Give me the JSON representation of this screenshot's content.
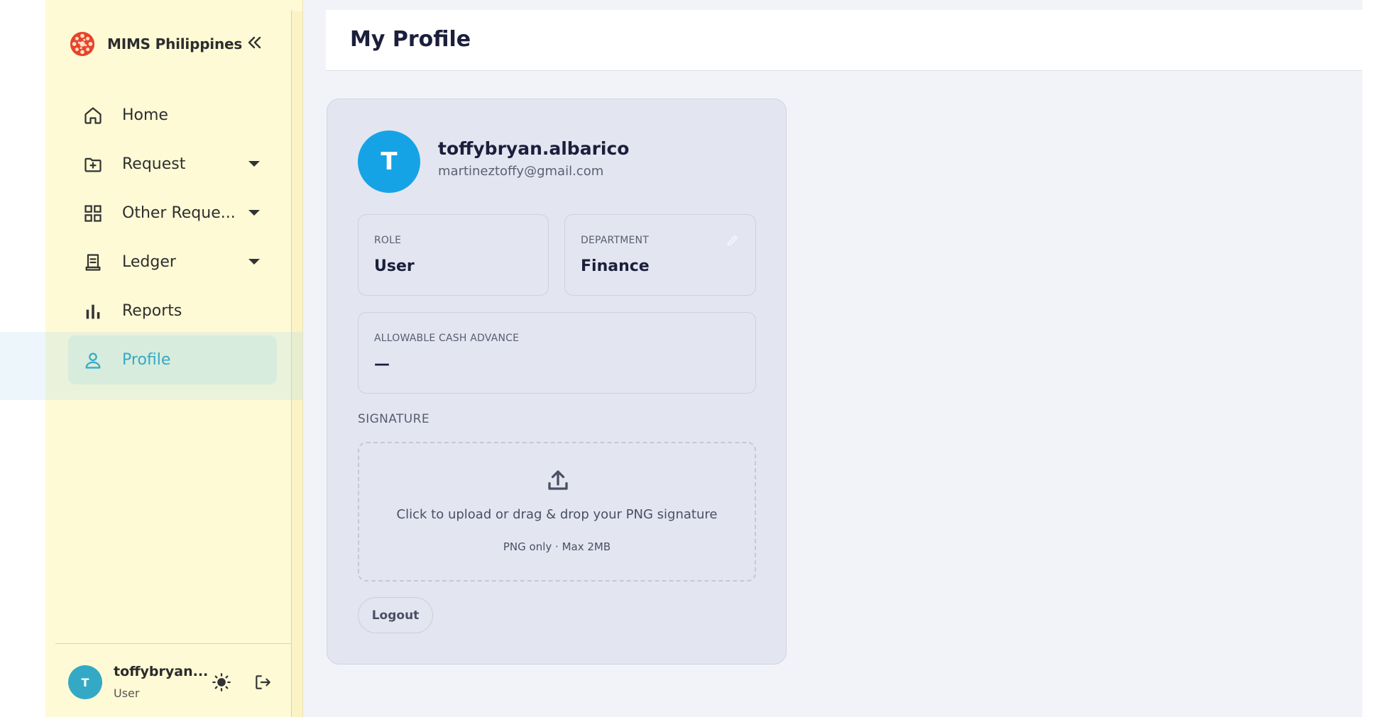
{
  "brand": {
    "name": "MIMS Philippines"
  },
  "sidebar": {
    "items": [
      {
        "label": "Home",
        "icon": "home-icon"
      },
      {
        "label": "Request",
        "icon": "folder-plus-icon",
        "has_caret": true
      },
      {
        "label": "Other Reque...",
        "icon": "grid-icon",
        "has_caret": true
      },
      {
        "label": "Ledger",
        "icon": "receipt-icon",
        "has_caret": true
      },
      {
        "label": "Reports",
        "icon": "bar-chart-icon"
      },
      {
        "label": "Profile",
        "icon": "user-icon",
        "active": true
      }
    ],
    "footer": {
      "avatar_initial": "T",
      "name": "toffybryan...",
      "role": "User"
    }
  },
  "header": {
    "title": "My Profile"
  },
  "profile": {
    "avatar_initial": "T",
    "username": "toffybryan.albarico",
    "email": "martineztoffy@gmail.com",
    "role": {
      "label": "ROLE",
      "value": "User"
    },
    "department": {
      "label": "DEPARTMENT",
      "value": "Finance"
    },
    "cash_advance": {
      "label": "ALLOWABLE CASH ADVANCE",
      "value": "—"
    },
    "signature": {
      "label": "SIGNATURE",
      "upload_text": "Click to upload or drag & drop your PNG signature",
      "upload_hint": "PNG only · Max 2MB"
    },
    "logout_label": "Logout"
  },
  "colors": {
    "sidebar_bg": "#fefad6",
    "accent": "#34a9c6",
    "avatar_blue": "#16a3e6",
    "main_bg": "#f2f3f8",
    "card_bg": "#e3e6f1",
    "title_text": "#1b1f3b"
  }
}
